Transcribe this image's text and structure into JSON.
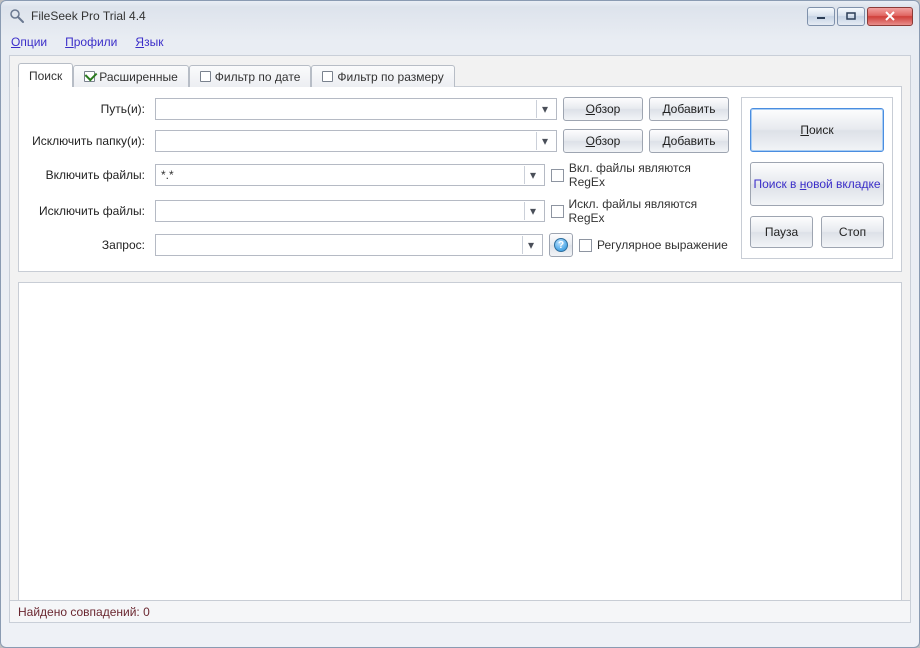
{
  "window": {
    "title": "FileSeek Pro Trial 4.4"
  },
  "menu": {
    "items": [
      {
        "pre": "",
        "u": "О",
        "post": "пции"
      },
      {
        "pre": "",
        "u": "П",
        "post": "рофили"
      },
      {
        "pre": "",
        "u": "Я",
        "post": "зык"
      }
    ]
  },
  "tabs": {
    "search": "Поиск",
    "advanced": "Расширенные",
    "date_filter": "Фильтр по дате",
    "size_filter": "Фильтр по размеру"
  },
  "form": {
    "path_label": "Путь(и):",
    "exclude_folder_label": "Исключить папку(и):",
    "include_files_label": "Включить файлы:",
    "exclude_files_label": "Исключить файлы:",
    "query_label": "Запрос:",
    "include_files_value": "*.*",
    "browse": {
      "u": "О",
      "post": "бзор"
    },
    "add": {
      "u": "Д",
      "post": "обавить"
    },
    "include_regex": "Вкл. файлы являются RegEx",
    "exclude_regex": "Искл. файлы являются RegEx",
    "regex": "Регулярное выражение"
  },
  "side": {
    "search": {
      "u": "П",
      "post": "оиск"
    },
    "search_new_tab": {
      "pre": "Поиск в ",
      "u": "н",
      "post": "овой вкладке"
    },
    "pause": "Пауза",
    "stop": "Стоп"
  },
  "status": {
    "matches": "Найдено совпадений: 0"
  }
}
